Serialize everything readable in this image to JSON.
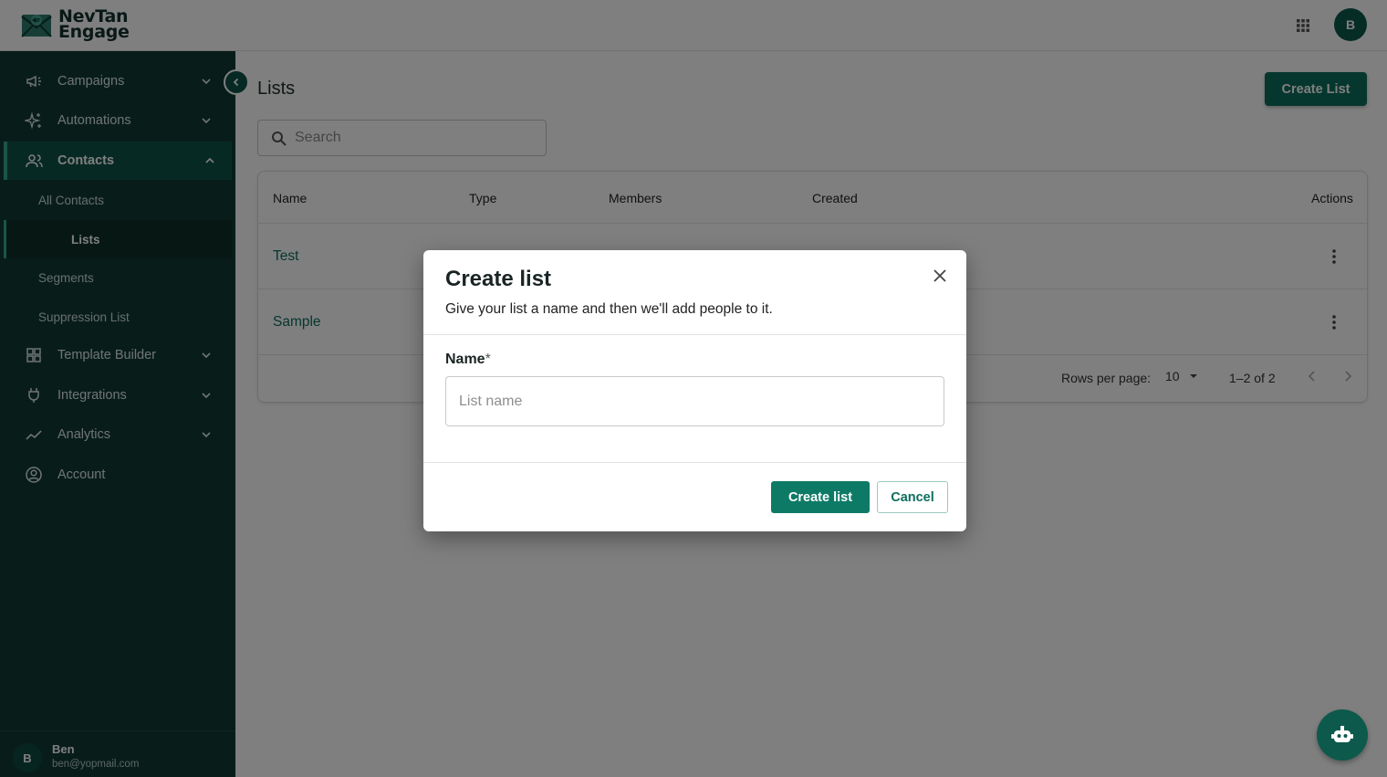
{
  "brand": {
    "line1": "NevTan",
    "line2": "Engage"
  },
  "user": {
    "initial": "B",
    "name": "Ben",
    "email": "ben@yopmail.com"
  },
  "sidebar": {
    "items": [
      {
        "label": "Campaigns",
        "icon": "megaphone-icon"
      },
      {
        "label": "Automations",
        "icon": "sparkles-icon"
      },
      {
        "label": "Contacts",
        "icon": "people-icon"
      },
      {
        "label": "Template Builder",
        "icon": "grid-icon"
      },
      {
        "label": "Integrations",
        "icon": "plug-icon"
      },
      {
        "label": "Analytics",
        "icon": "trend-icon"
      },
      {
        "label": "Account",
        "icon": "user-circle-icon"
      }
    ],
    "contacts_sub": [
      "All Contacts",
      "Lists",
      "Segments",
      "Suppression List"
    ]
  },
  "page": {
    "title": "Lists",
    "create_button": "Create List",
    "search_placeholder": "Search"
  },
  "table": {
    "columns": [
      "Name",
      "Type",
      "Members",
      "Created",
      "Actions"
    ],
    "rows": [
      {
        "name": "Test"
      },
      {
        "name": "Sample"
      }
    ],
    "pagination": {
      "rows_per_page_label": "Rows per page:",
      "rows_per_page": "10",
      "range": "1–2 of 2"
    }
  },
  "modal": {
    "title": "Create list",
    "subtitle": "Give your list a name and then we'll add people to it.",
    "field_label": "Name",
    "required_mark": "*",
    "field_placeholder": "List name",
    "primary_button": "Create list",
    "secondary_button": "Cancel"
  },
  "colors": {
    "primary": "#0d6e5c",
    "sidebar": "#103b35"
  }
}
